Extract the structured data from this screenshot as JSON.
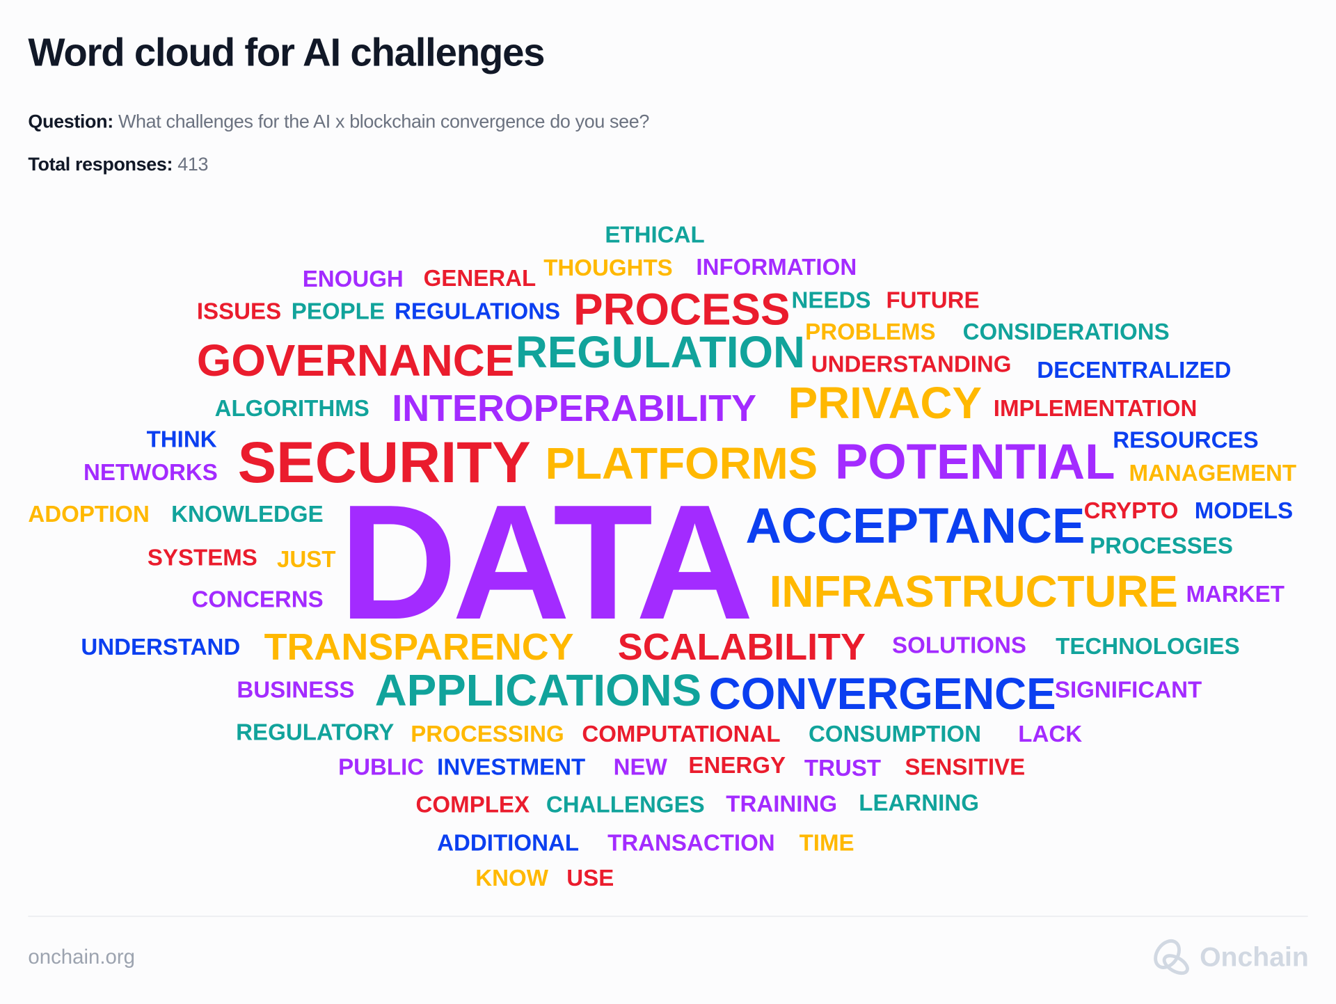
{
  "header": {
    "title": "Word cloud for AI challenges",
    "question_label": "Question:",
    "question": "What challenges for the AI x blockchain convergence do you see?",
    "responses_label": "Total responses:",
    "responses": "413"
  },
  "colors": {
    "red": "#ea1c2d",
    "purple": "#a32bff",
    "yellow": "#ffb800",
    "teal": "#11a39b",
    "blue": "#0b3ff0"
  },
  "words": [
    {
      "text": "ETHICAL",
      "color": "teal"
    },
    {
      "text": "ENOUGH",
      "color": "purple"
    },
    {
      "text": "GENERAL",
      "color": "red"
    },
    {
      "text": "THOUGHTS",
      "color": "yellow"
    },
    {
      "text": "INFORMATION",
      "color": "purple"
    },
    {
      "text": "ISSUES",
      "color": "red"
    },
    {
      "text": "PEOPLE",
      "color": "teal"
    },
    {
      "text": "REGULATIONS",
      "color": "blue"
    },
    {
      "text": "PROCESS",
      "color": "red"
    },
    {
      "text": "NEEDS",
      "color": "teal"
    },
    {
      "text": "FUTURE",
      "color": "red"
    },
    {
      "text": "PROBLEMS",
      "color": "yellow"
    },
    {
      "text": "CONSIDERATIONS",
      "color": "teal"
    },
    {
      "text": "GOVERNANCE",
      "color": "red"
    },
    {
      "text": "REGULATION",
      "color": "teal"
    },
    {
      "text": "UNDERSTANDING",
      "color": "red"
    },
    {
      "text": "DECENTRALIZED",
      "color": "blue"
    },
    {
      "text": "ALGORITHMS",
      "color": "teal"
    },
    {
      "text": "INTEROPERABILITY",
      "color": "purple"
    },
    {
      "text": "PRIVACY",
      "color": "yellow"
    },
    {
      "text": "IMPLEMENTATION",
      "color": "red"
    },
    {
      "text": "THINK",
      "color": "blue"
    },
    {
      "text": "RESOURCES",
      "color": "blue"
    },
    {
      "text": "NETWORKS",
      "color": "purple"
    },
    {
      "text": "SECURITY",
      "color": "red"
    },
    {
      "text": "PLATFORMS",
      "color": "yellow"
    },
    {
      "text": "POTENTIAL",
      "color": "purple"
    },
    {
      "text": "MANAGEMENT",
      "color": "yellow"
    },
    {
      "text": "ADOPTION",
      "color": "yellow"
    },
    {
      "text": "KNOWLEDGE",
      "color": "teal"
    },
    {
      "text": "DATA",
      "color": "purple"
    },
    {
      "text": "ACCEPTANCE",
      "color": "blue"
    },
    {
      "text": "CRYPTO",
      "color": "red"
    },
    {
      "text": "MODELS",
      "color": "blue"
    },
    {
      "text": "PROCESSES",
      "color": "teal"
    },
    {
      "text": "SYSTEMS",
      "color": "red"
    },
    {
      "text": "JUST",
      "color": "yellow"
    },
    {
      "text": "INFRASTRUCTURE",
      "color": "yellow"
    },
    {
      "text": "CONCERNS",
      "color": "purple"
    },
    {
      "text": "MARKET",
      "color": "purple"
    },
    {
      "text": "UNDERSTAND",
      "color": "blue"
    },
    {
      "text": "TRANSPARENCY",
      "color": "yellow"
    },
    {
      "text": "SCALABILITY",
      "color": "red"
    },
    {
      "text": "SOLUTIONS",
      "color": "purple"
    },
    {
      "text": "TECHNOLOGIES",
      "color": "teal"
    },
    {
      "text": "BUSINESS",
      "color": "purple"
    },
    {
      "text": "APPLICATIONS",
      "color": "teal"
    },
    {
      "text": "CONVERGENCE",
      "color": "blue"
    },
    {
      "text": "SIGNIFICANT",
      "color": "purple"
    },
    {
      "text": "REGULATORY",
      "color": "teal"
    },
    {
      "text": "PROCESSING",
      "color": "yellow"
    },
    {
      "text": "COMPUTATIONAL",
      "color": "red"
    },
    {
      "text": "CONSUMPTION",
      "color": "teal"
    },
    {
      "text": "LACK",
      "color": "purple"
    },
    {
      "text": "PUBLIC",
      "color": "purple"
    },
    {
      "text": "INVESTMENT",
      "color": "blue"
    },
    {
      "text": "NEW",
      "color": "purple"
    },
    {
      "text": "ENERGY",
      "color": "red"
    },
    {
      "text": "TRUST",
      "color": "purple"
    },
    {
      "text": "SENSITIVE",
      "color": "red"
    },
    {
      "text": "COMPLEX",
      "color": "red"
    },
    {
      "text": "CHALLENGES",
      "color": "teal"
    },
    {
      "text": "TRAINING",
      "color": "purple"
    },
    {
      "text": "LEARNING",
      "color": "teal"
    },
    {
      "text": "ADDITIONAL",
      "color": "blue"
    },
    {
      "text": "TRANSACTION",
      "color": "purple"
    },
    {
      "text": "TIME",
      "color": "yellow"
    },
    {
      "text": "KNOW",
      "color": "yellow"
    },
    {
      "text": "USE",
      "color": "red"
    }
  ],
  "footer": {
    "site": "onchain.org",
    "logo": "Onchain"
  }
}
